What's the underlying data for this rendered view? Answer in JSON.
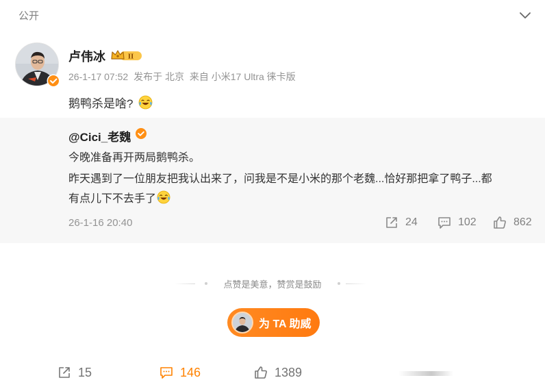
{
  "header": {
    "visibility_label": "公开"
  },
  "post": {
    "author": {
      "name": "卢伟冰",
      "vip_level": "II"
    },
    "meta": {
      "time": "26-1-17 07:52",
      "location": "发布于 北京",
      "source": "来自 小米17 Ultra 徕卡版"
    },
    "text": "鹅鸭杀是啥?",
    "emoji": "laugh-cry-emoji"
  },
  "repost": {
    "author": "@Cici_老魏",
    "line1": "今晚准备再开两局鹅鸭杀。",
    "line2": "昨天遇到了一位朋友把我认出来了，问我是不是小米的那个老魏...恰好那把拿了鸭子...都",
    "line3": "有点儿下不去手了",
    "time": "26-1-16 20:40",
    "stats": {
      "reposts": "24",
      "comments": "102",
      "likes": "862"
    }
  },
  "divider": {
    "text": "点赞是美意，赞赏是鼓励"
  },
  "support_button": {
    "label": "为 TA 助威"
  },
  "bottom_bar": {
    "reposts": "15",
    "comments": "146",
    "likes": "1389"
  },
  "colors": {
    "accent": "#ff8200",
    "repost_bg": "#f7f7f7",
    "verify_badge": "#ff8f14"
  }
}
